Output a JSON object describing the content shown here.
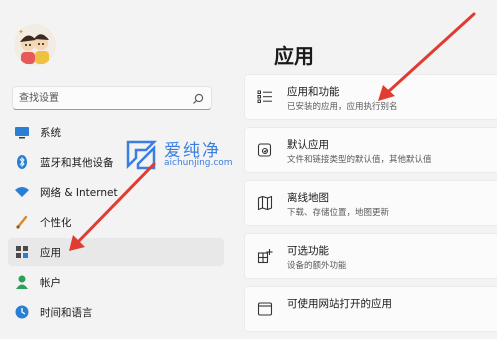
{
  "page": {
    "title": "应用"
  },
  "search": {
    "placeholder": "查找设置",
    "icon": "search-icon"
  },
  "sidebar": {
    "items": [
      {
        "label": "系统",
        "icon": "monitor-icon",
        "active": false
      },
      {
        "label": "蓝牙和其他设备",
        "icon": "bluetooth-icon",
        "active": false
      },
      {
        "label": "网络 & Internet",
        "icon": "wifi-icon",
        "active": false
      },
      {
        "label": "个性化",
        "icon": "brush-icon",
        "active": false
      },
      {
        "label": "应用",
        "icon": "apps-icon",
        "active": true
      },
      {
        "label": "帐户",
        "icon": "person-icon",
        "active": false
      },
      {
        "label": "时间和语言",
        "icon": "globe-clock-icon",
        "active": false
      }
    ]
  },
  "cards": [
    {
      "title": "应用和功能",
      "subtitle": "已安装的应用，应用执行别名",
      "icon": "list-icon"
    },
    {
      "title": "默认应用",
      "subtitle": "文件和链接类型的默认值，其他默认值",
      "icon": "default-app-icon"
    },
    {
      "title": "离线地图",
      "subtitle": "下载、存储位置，地图更新",
      "icon": "map-icon"
    },
    {
      "title": "可选功能",
      "subtitle": "设备的额外功能",
      "icon": "optional-features-icon"
    },
    {
      "title": "可使用网站打开的应用",
      "subtitle": "",
      "icon": "web-app-icon"
    }
  ],
  "watermark": {
    "text": "爱纯净",
    "url": "aichunjing.com"
  },
  "colors": {
    "arrow": "#e03c31",
    "accent": "#0067c0",
    "watermark": "#3b7de0"
  }
}
